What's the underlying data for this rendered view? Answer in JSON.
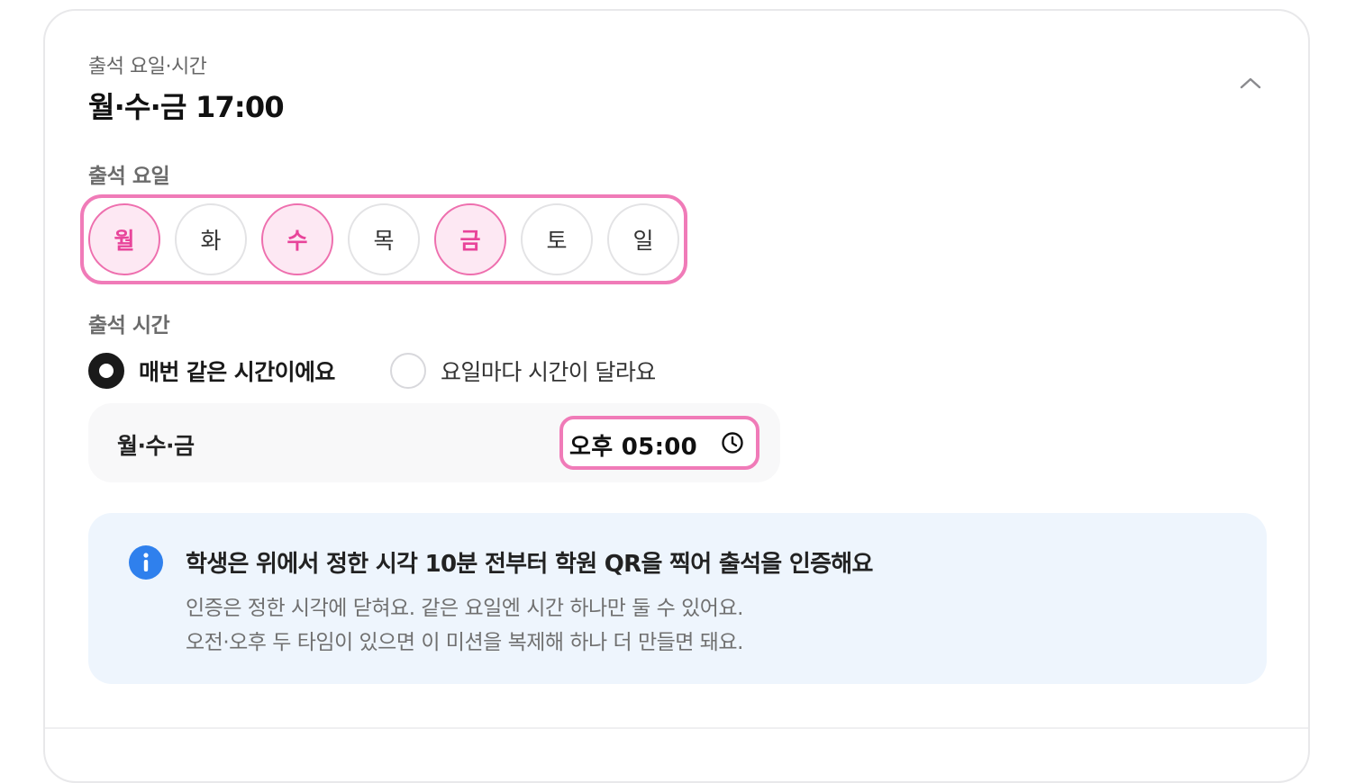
{
  "header": {
    "subtitle": "출석 요일·시간",
    "title": "월·수·금 17:00",
    "collapse_icon": "chevron-up-icon"
  },
  "days_section": {
    "label": "출석 요일",
    "days": [
      {
        "label": "월",
        "selected": true
      },
      {
        "label": "화",
        "selected": false
      },
      {
        "label": "수",
        "selected": true
      },
      {
        "label": "목",
        "selected": false
      },
      {
        "label": "금",
        "selected": true
      },
      {
        "label": "토",
        "selected": false
      },
      {
        "label": "일",
        "selected": false
      }
    ],
    "accent_color": "#f07bb8"
  },
  "time_section": {
    "label": "출석 시간",
    "options": [
      {
        "label": "매번 같은 시간이에요",
        "checked": true
      },
      {
        "label": "요일마다 시간이 달라요",
        "checked": false
      }
    ],
    "row": {
      "days": "월·수·금",
      "time": "오후 05:00",
      "icon": "clock-icon"
    }
  },
  "info": {
    "icon": "info-icon",
    "title": "학생은 위에서 정한 시각 10분 전부터 학원 QR을 찍어 출석을 인증해요",
    "lines": [
      "인증은 정한 시각에 닫혀요. 같은 요일엔 시간 하나만 둘 수 있어요.",
      "오전·오후 두 타임이 있으면 이 미션을 복제해 하나 더 만들면 돼요."
    ],
    "icon_color": "#2f80ed"
  }
}
